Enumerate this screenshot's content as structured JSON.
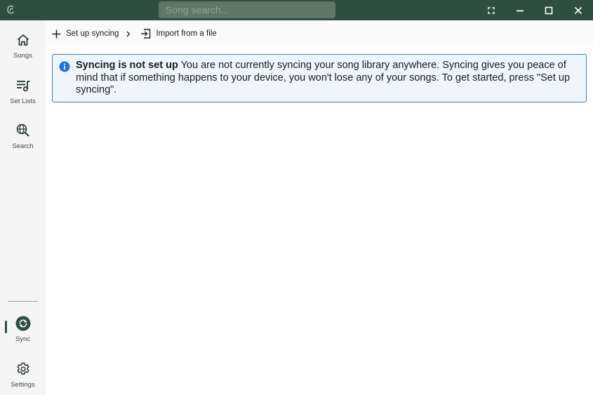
{
  "titlebar": {
    "search_placeholder": "Song search...",
    "color": "#2f4d40"
  },
  "sidebar": {
    "items": [
      {
        "id": "songs",
        "label": "Songs",
        "icon": "home-icon"
      },
      {
        "id": "setlists",
        "label": "Set Lists",
        "icon": "playlist-icon"
      },
      {
        "id": "search",
        "label": "Search",
        "icon": "globe-search-icon"
      }
    ],
    "bottom_items": [
      {
        "id": "sync",
        "label": "Sync",
        "icon": "sync-icon",
        "active": true
      },
      {
        "id": "settings",
        "label": "Settings",
        "icon": "gear-icon"
      }
    ]
  },
  "toolbar": {
    "setup_label": "Set up syncing",
    "import_label": "Import from a file"
  },
  "banner": {
    "title": "Syncing is not set up",
    "message": " You are not currently syncing your song library anywhere. Syncing gives you peace of mind that if something happens to your device, you won't lose any of your songs. To get started, press \"Set up syncing\".",
    "accent": "#1a73e8"
  }
}
